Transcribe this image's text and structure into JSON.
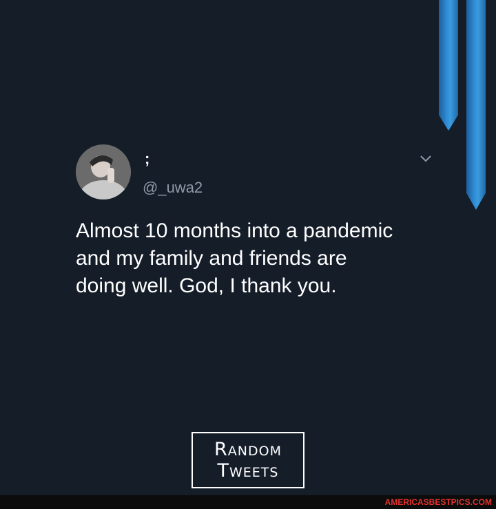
{
  "tweet": {
    "display_name": ";",
    "handle": "@_uwa2",
    "text": "Almost 10 months into a pandemic and my family and friends are doing well. God, I thank you.",
    "more_icon": "chevron-down-icon",
    "avatar": "user-avatar"
  },
  "watermark": {
    "line1": "Random",
    "line2": "Tweets"
  },
  "footer": {
    "site": "AMERICASBESTPICS.COM"
  },
  "colors": {
    "background": "#151d29",
    "ribbon": "#2f8bd4",
    "text": "#ffffff",
    "handle": "#8f9aa6",
    "footer_site": "#e5322d"
  }
}
